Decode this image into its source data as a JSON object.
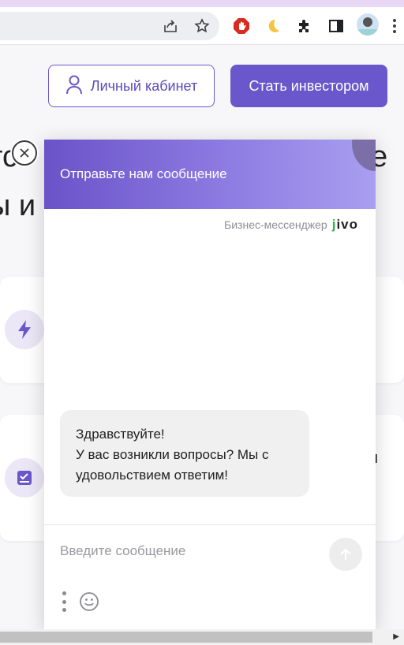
{
  "browser": {
    "icons": [
      "share-icon",
      "star-icon",
      "adblock-extension-icon",
      "moon-extension-icon",
      "puzzle-extensions-icon",
      "sidepanel-icon",
      "profile-avatar",
      "menu-kebab-icon"
    ]
  },
  "header": {
    "cabinet_label": "Личный кабинет",
    "invest_label": "Стать инвестором"
  },
  "hero": {
    "line1": "тсо",
    "line1_right": "е",
    "line2": "ы и"
  },
  "chat": {
    "title": "Отправьте нам сообщение",
    "brand_label": "Бизнес-мессенджер",
    "brand_logo": "jivo",
    "greeting_line1": "Здравствуйте!",
    "greeting_line2": "У вас возникли вопросы? Мы с удовольствием ответим!",
    "input_placeholder": "Введите сообщение"
  },
  "colors": {
    "accent": "#6b57cc",
    "header_gradient_start": "#6a53c8",
    "header_gradient_end": "#a99ef0",
    "jivo_green": "#2cb34a"
  }
}
